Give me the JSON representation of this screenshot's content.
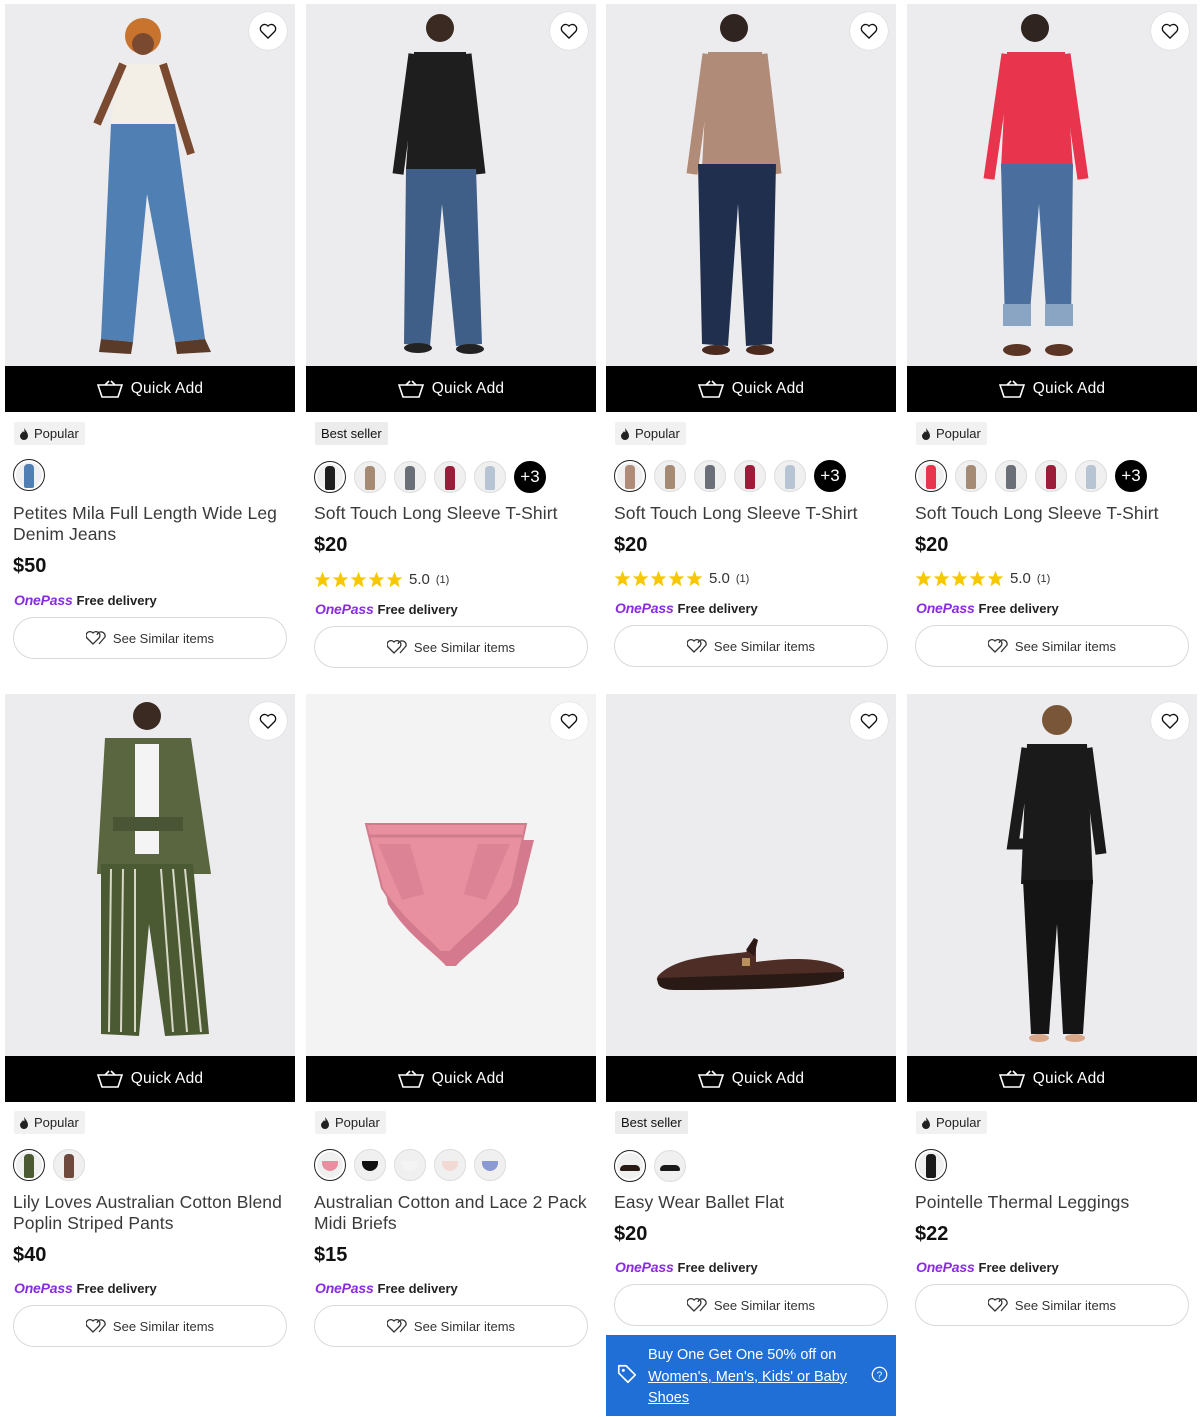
{
  "quick_add_label": "Quick Add",
  "similar_label": "See Similar items",
  "onepass_brand": "OnePass",
  "free_delivery": "Free delivery",
  "colors": {
    "accent_black": "#000000",
    "onepass_purple": "#8a2be2",
    "promo_blue": "#1f6fd6",
    "star_yellow": "#f7c800"
  },
  "products": [
    {
      "badge": "Popular",
      "title": "Petites Mila Full Length Wide Leg Denim Jeans",
      "price": "$50",
      "rating": "",
      "rating_count": "",
      "more": ""
    },
    {
      "badge": "Best seller",
      "title": "Soft Touch Long Sleeve T-Shirt",
      "price": "$20",
      "rating": "5.0",
      "rating_count": "(1)",
      "more": "+3"
    },
    {
      "badge": "Popular",
      "title": "Soft Touch Long Sleeve T-Shirt",
      "price": "$20",
      "rating": "5.0",
      "rating_count": "(1)",
      "more": "+3"
    },
    {
      "badge": "Popular",
      "title": "Soft Touch Long Sleeve T-Shirt",
      "price": "$20",
      "rating": "5.0",
      "rating_count": "(1)",
      "more": "+3"
    },
    {
      "badge": "Popular",
      "title": "Lily Loves Australian Cotton Blend Poplin Striped Pants",
      "price": "$40",
      "rating": "",
      "rating_count": "",
      "more": ""
    },
    {
      "badge": "Popular",
      "title": "Australian Cotton and Lace 2 Pack Midi Briefs",
      "price": "$15",
      "rating": "",
      "rating_count": "",
      "more": ""
    },
    {
      "badge": "Best seller",
      "title": "Easy Wear Ballet Flat",
      "price": "$20",
      "rating": "",
      "rating_count": "",
      "more": ""
    },
    {
      "badge": "Popular",
      "title": "Pointelle Thermal Leggings",
      "price": "$22",
      "rating": "",
      "rating_count": "",
      "more": ""
    }
  ],
  "promo": {
    "text": "Buy One Get One 50% off on",
    "link": "Women's, Men's, Kids' or Baby Shoes"
  }
}
